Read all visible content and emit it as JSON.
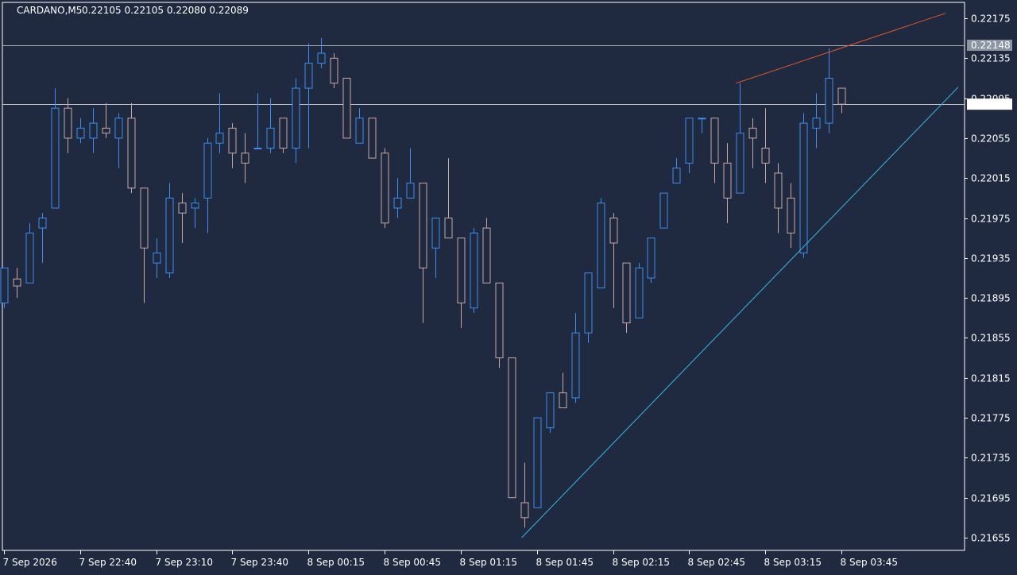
{
  "header": {
    "symbol_timeframe": "CARDANO,M5",
    "ohlc": "0.22105 0.22105 0.22080 0.22089"
  },
  "colors": {
    "background": "#1f2a40",
    "axis": "#ffffff",
    "bull": "#3d8ef0",
    "bear": "#c9a6a6",
    "horizontal_line": "#c8c8c8",
    "trendline_support": "#35b6e6",
    "trendline_resistance": "#e0552b",
    "bid_label_bg": "#ffffff",
    "line_label_bg": "#8c96a3"
  },
  "chart_data": {
    "type": "candlestick",
    "symbol": "CARDANO",
    "timeframe": "M5",
    "ylim": [
      0.21645,
      0.22181
    ],
    "y_ticks": [
      "0.22175",
      "0.22135",
      "0.22095",
      "0.22055",
      "0.22015",
      "0.21975",
      "0.21935",
      "0.21895",
      "0.21855",
      "0.21815",
      "0.21775",
      "0.21735",
      "0.21695",
      "0.21655"
    ],
    "x_labels": [
      {
        "i": 0,
        "label": "7 Sep 2026"
      },
      {
        "i": 6,
        "label": "7 Sep 22:40"
      },
      {
        "i": 12,
        "label": "7 Sep 23:10"
      },
      {
        "i": 18,
        "label": "7 Sep 23:40"
      },
      {
        "i": 24,
        "label": "8 Sep 00:15"
      },
      {
        "i": 30,
        "label": "8 Sep 00:45"
      },
      {
        "i": 36,
        "label": "8 Sep 01:15"
      },
      {
        "i": 42,
        "label": "8 Sep 01:45"
      },
      {
        "i": 48,
        "label": "8 Sep 02:15"
      },
      {
        "i": 54,
        "label": "8 Sep 02:45"
      },
      {
        "i": 60,
        "label": "8 Sep 03:15"
      },
      {
        "i": 66,
        "label": "8 Sep 03:45"
      }
    ],
    "candles": [
      [
        0.2189,
        0.21925,
        0.21885,
        0.21925
      ],
      [
        0.21914,
        0.21925,
        0.21895,
        0.21907
      ],
      [
        0.2191,
        0.2197,
        0.2191,
        0.2196
      ],
      [
        0.21965,
        0.2198,
        0.2193,
        0.21975
      ],
      [
        0.21985,
        0.22105,
        0.21985,
        0.22085
      ],
      [
        0.22085,
        0.22095,
        0.2204,
        0.22055
      ],
      [
        0.22055,
        0.22075,
        0.2205,
        0.22065
      ],
      [
        0.22055,
        0.22085,
        0.2204,
        0.2207
      ],
      [
        0.22065,
        0.2209,
        0.22055,
        0.2206
      ],
      [
        0.22055,
        0.2208,
        0.22025,
        0.22075
      ],
      [
        0.22075,
        0.2209,
        0.22,
        0.22005
      ],
      [
        0.22005,
        0.22005,
        0.2189,
        0.21945
      ],
      [
        0.2193,
        0.21955,
        0.21915,
        0.2194
      ],
      [
        0.2192,
        0.2201,
        0.21915,
        0.21995
      ],
      [
        0.2199,
        0.22,
        0.2195,
        0.2198
      ],
      [
        0.21985,
        0.21995,
        0.21965,
        0.2199
      ],
      [
        0.21995,
        0.22055,
        0.2196,
        0.2205
      ],
      [
        0.2205,
        0.221,
        0.2204,
        0.2206
      ],
      [
        0.22065,
        0.2207,
        0.22025,
        0.2204
      ],
      [
        0.2204,
        0.2206,
        0.2201,
        0.2203
      ],
      [
        0.22045,
        0.221,
        0.22045,
        0.22045
      ],
      [
        0.22045,
        0.22095,
        0.2204,
        0.22065
      ],
      [
        0.22075,
        0.22075,
        0.2204,
        0.22045
      ],
      [
        0.22045,
        0.22115,
        0.2203,
        0.22105
      ],
      [
        0.22105,
        0.2215,
        0.22045,
        0.2213
      ],
      [
        0.2213,
        0.22155,
        0.22125,
        0.2214
      ],
      [
        0.22135,
        0.2214,
        0.22105,
        0.2211
      ],
      [
        0.22115,
        0.22115,
        0.22055,
        0.22055
      ],
      [
        0.2205,
        0.22085,
        0.2205,
        0.22075
      ],
      [
        0.22075,
        0.22075,
        0.22035,
        0.22035
      ],
      [
        0.2204,
        0.22045,
        0.21965,
        0.2197
      ],
      [
        0.21985,
        0.22015,
        0.21975,
        0.21995
      ],
      [
        0.21995,
        0.22045,
        0.21995,
        0.2201
      ],
      [
        0.2201,
        0.2201,
        0.2187,
        0.21925
      ],
      [
        0.21945,
        0.21975,
        0.21915,
        0.21975
      ],
      [
        0.21975,
        0.22035,
        0.21955,
        0.21955
      ],
      [
        0.21955,
        0.21955,
        0.21865,
        0.2189
      ],
      [
        0.21885,
        0.21965,
        0.2188,
        0.2196
      ],
      [
        0.21965,
        0.21975,
        0.2191,
        0.2191
      ],
      [
        0.2191,
        0.2191,
        0.21825,
        0.21835
      ],
      [
        0.21835,
        0.21835,
        0.21695,
        0.21695
      ],
      [
        0.2169,
        0.2173,
        0.21665,
        0.21675
      ],
      [
        0.21685,
        0.21775,
        0.21685,
        0.21775
      ],
      [
        0.21765,
        0.218,
        0.2176,
        0.218
      ],
      [
        0.218,
        0.2182,
        0.21785,
        0.21785
      ],
      [
        0.21795,
        0.2188,
        0.2179,
        0.2186
      ],
      [
        0.2186,
        0.2192,
        0.2185,
        0.2192
      ],
      [
        0.21905,
        0.21995,
        0.21905,
        0.2199
      ],
      [
        0.21975,
        0.2198,
        0.21885,
        0.2195
      ],
      [
        0.2193,
        0.2193,
        0.2186,
        0.2187
      ],
      [
        0.21875,
        0.2193,
        0.21875,
        0.21925
      ],
      [
        0.21915,
        0.21955,
        0.2191,
        0.21955
      ],
      [
        0.21965,
        0.22,
        0.21965,
        0.22
      ],
      [
        0.2201,
        0.22035,
        0.2201,
        0.22025
      ],
      [
        0.2203,
        0.22075,
        0.2202,
        0.22075
      ],
      [
        0.22075,
        0.22075,
        0.2206,
        0.22075
      ],
      [
        0.22075,
        0.22075,
        0.2201,
        0.2203
      ],
      [
        0.2203,
        0.2205,
        0.2197,
        0.21995
      ],
      [
        0.22,
        0.2211,
        0.22,
        0.2206
      ],
      [
        0.22065,
        0.22075,
        0.22025,
        0.22055
      ],
      [
        0.22045,
        0.22085,
        0.2201,
        0.2203
      ],
      [
        0.2202,
        0.2203,
        0.2196,
        0.21985
      ],
      [
        0.21995,
        0.2201,
        0.21945,
        0.2196
      ],
      [
        0.2194,
        0.2208,
        0.21935,
        0.2207
      ],
      [
        0.22065,
        0.221,
        0.22045,
        0.22075
      ],
      [
        0.2207,
        0.22145,
        0.2206,
        0.22115
      ],
      [
        0.22105,
        0.22105,
        0.2208,
        0.22089
      ]
    ],
    "horizontal_lines": [
      {
        "price": 0.22148,
        "label": "0.22148"
      }
    ],
    "bid": {
      "price": 0.22089,
      "label": "0.22089"
    },
    "trendlines": [
      {
        "name": "support",
        "from": {
          "i": 40.8,
          "price": 0.21655
        },
        "to": {
          "i": 75.2,
          "price": 0.22106
        }
      },
      {
        "name": "resistance",
        "from": {
          "i": 57.7,
          "price": 0.2211
        },
        "to": {
          "i": 74.2,
          "price": 0.2218
        }
      }
    ]
  }
}
